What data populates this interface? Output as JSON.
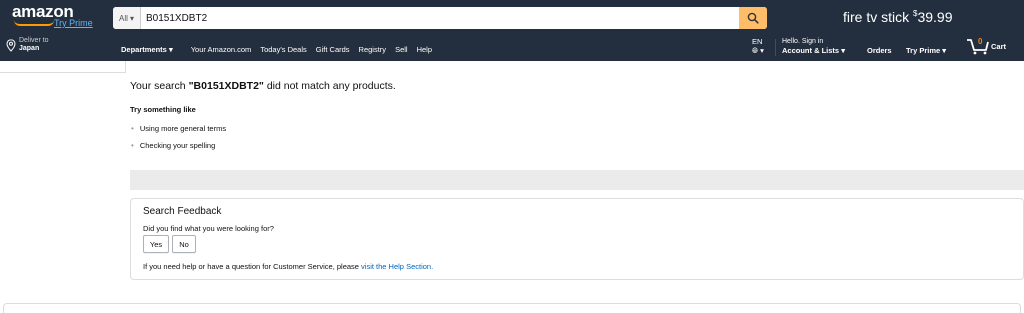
{
  "header": {
    "logo_text": "amazon",
    "try_prime": "Try Prime",
    "search": {
      "category": "All",
      "value": "B0151XDBT2"
    },
    "promo": {
      "text": "fire tv stick",
      "dollar": "$",
      "price": "39.99"
    }
  },
  "nav": {
    "deliver_line1": "Deliver to",
    "deliver_line2": "Japan",
    "departments": "Departments",
    "links": [
      "Your Amazon.com",
      "Today's Deals",
      "Gift Cards",
      "Registry",
      "Sell",
      "Help"
    ],
    "language": "EN",
    "account_line1": "Hello. Sign in",
    "account_line2": "Account & Lists",
    "orders": "Orders",
    "try_prime": "Try Prime",
    "cart_count": "0",
    "cart_label": "Cart"
  },
  "results": {
    "prefix": "Your search ",
    "query": "\"B0151XDBT2\"",
    "suffix": " did not match any products.",
    "try_heading": "Try something like",
    "suggestions": [
      "Using more general terms",
      "Checking your spelling"
    ]
  },
  "feedback": {
    "title": "Search Feedback",
    "question": "Did you find what you were looking for?",
    "yes": "Yes",
    "no": "No",
    "help_text": "If you need help or have a question for Customer Service, please ",
    "help_link": "visit the Help Section."
  },
  "colors": {
    "nav_bg": "#232f3e",
    "search_button": "#febd69",
    "link": "#0066c0",
    "prime_blue": "#5eb6f2"
  }
}
